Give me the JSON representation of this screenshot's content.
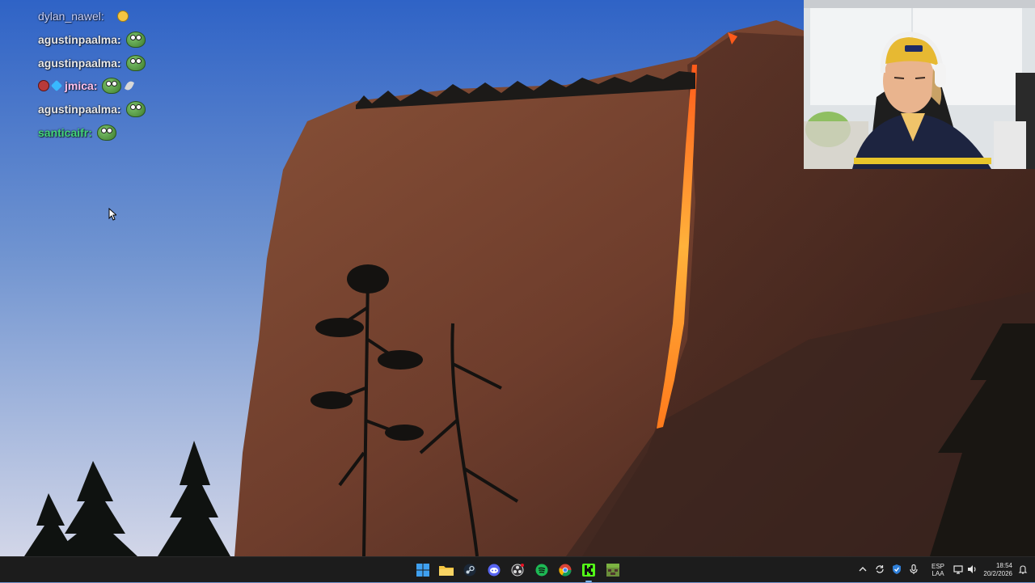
{
  "chat": {
    "messages": [
      {
        "user": "dylan_nawel",
        "color": "#c9d3ff",
        "emote": "laughing-emoji"
      },
      {
        "user": "agustinpaalma",
        "color": "#e9e9e9",
        "emote": "frog-emote"
      },
      {
        "user": "agustinpaalma",
        "color": "#e9e9e9",
        "emote": "frog-emote"
      },
      {
        "user": "jmica",
        "color": "#ffc2ee",
        "emote": "frog-emote",
        "badges": [
          "red-badge",
          "blue-diamond-badge"
        ],
        "extra": "feather-emote"
      },
      {
        "user": "agustinpaalma",
        "color": "#e9e9e9",
        "emote": "frog-emote"
      },
      {
        "user": "santicaifr",
        "color": "#43d57a",
        "emote": "frog-emote"
      }
    ]
  },
  "taskbar": {
    "apps": [
      {
        "name": "start-button",
        "icon": "windows-icon"
      },
      {
        "name": "file-explorer",
        "icon": "folder-icon"
      },
      {
        "name": "steam",
        "icon": "steam-icon"
      },
      {
        "name": "discord",
        "icon": "discord-icon"
      },
      {
        "name": "obs",
        "icon": "obs-icon"
      },
      {
        "name": "spotify",
        "icon": "spotify-icon"
      },
      {
        "name": "chrome",
        "icon": "chrome-icon"
      },
      {
        "name": "kick",
        "icon": "kick-icon"
      },
      {
        "name": "minecraft",
        "icon": "minecraft-icon"
      }
    ],
    "tray": {
      "lang_top": "ESP",
      "lang_bottom": "LAA",
      "time": "18:54",
      "date": "20/2/2026"
    }
  },
  "colors": {
    "taskbar_bg": "#1c1c1c",
    "spotify_green": "#1db954",
    "kick_green": "#53fc18"
  }
}
